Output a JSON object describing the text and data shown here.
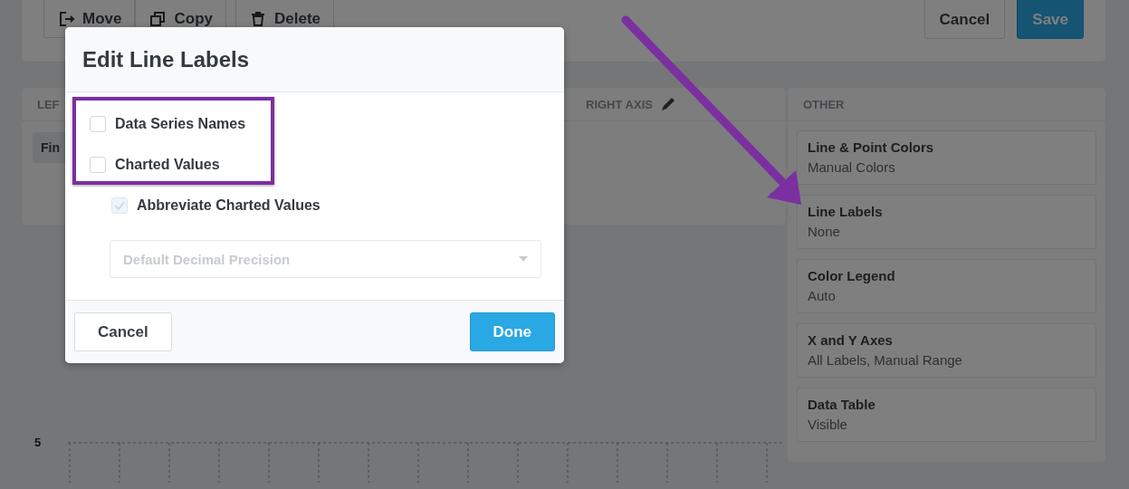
{
  "toolbar": {
    "buttons": [
      {
        "label": "Move"
      },
      {
        "label": "Copy"
      },
      {
        "label": "Delete"
      }
    ],
    "actions": [
      {
        "label": "Cancel",
        "kind": "secondary"
      },
      {
        "label": "Save",
        "kind": "primary"
      }
    ]
  },
  "axes_panel": {
    "left_heading": "LEF",
    "left_item": "Fin",
    "right_heading": "RIGHT AXIS"
  },
  "other_panel": {
    "heading": "OTHER",
    "cards": [
      {
        "title": "Line & Point Colors",
        "value": "Manual Colors"
      },
      {
        "title": "Line Labels",
        "value": "None"
      },
      {
        "title": "Color Legend",
        "value": "Auto"
      },
      {
        "title": "X and Y Axes",
        "value": "All Labels, Manual Range"
      },
      {
        "title": "Data Table",
        "value": "Visible"
      }
    ]
  },
  "chart": {
    "y_label": "5"
  },
  "dialog": {
    "title": "Edit Line Labels",
    "options": [
      {
        "label": "Data Series Names",
        "checked": false,
        "disabled": false,
        "indented": false
      },
      {
        "label": "Charted Values",
        "checked": false,
        "disabled": false,
        "indented": false
      },
      {
        "label": "Abbreviate Charted Values",
        "checked": true,
        "disabled": true,
        "indented": true
      }
    ],
    "select": {
      "placeholder": "Default Decimal Precision",
      "disabled": true
    },
    "buttons": [
      {
        "label": "Cancel",
        "kind": "secondary"
      },
      {
        "label": "Done",
        "kind": "primary"
      }
    ]
  }
}
